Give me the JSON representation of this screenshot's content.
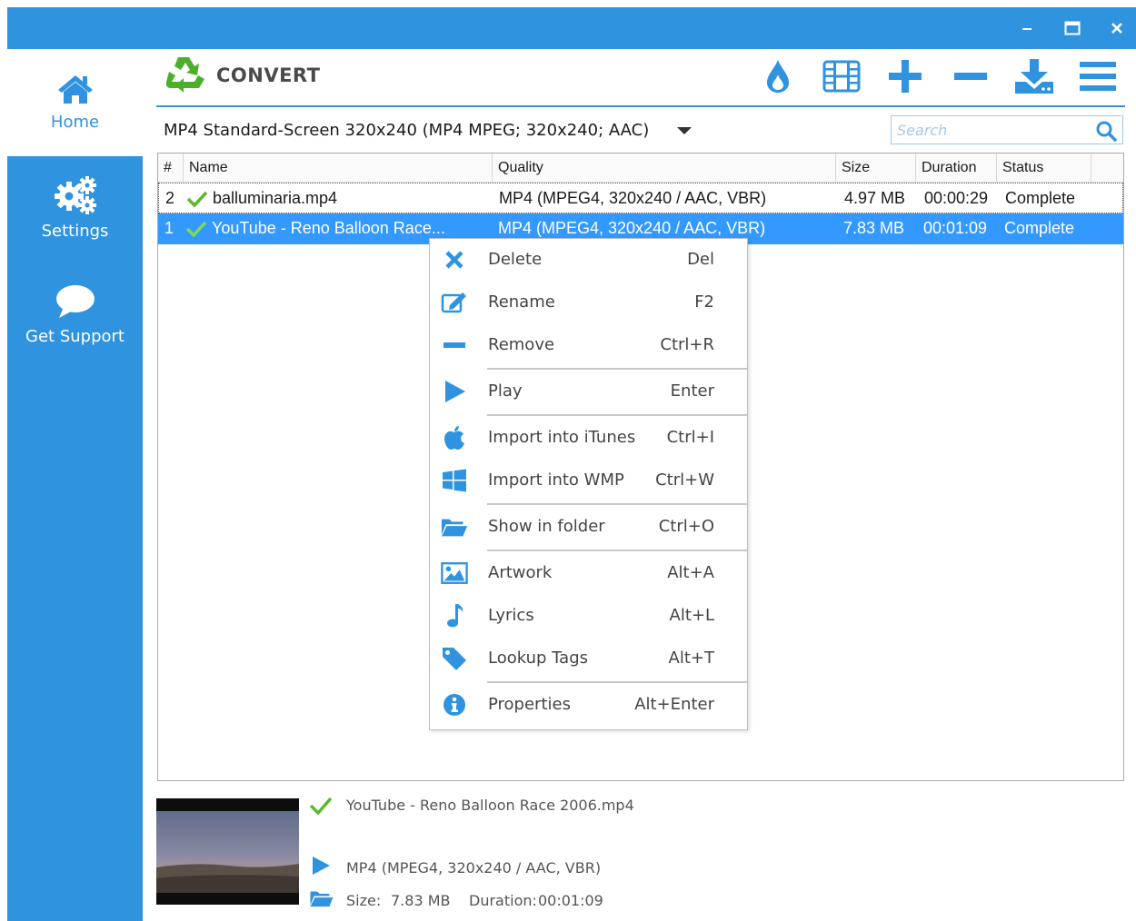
{
  "window": {
    "controls": {
      "minimize_icon": "minimize-icon",
      "maximize_icon": "maximize-icon",
      "close_icon": "close-icon"
    }
  },
  "sidebar": {
    "items": [
      {
        "label": "Home",
        "icon": "home-icon"
      },
      {
        "label": "Settings",
        "icon": "gears-icon"
      },
      {
        "label": "Get Support",
        "icon": "chat-bubble-icon"
      }
    ]
  },
  "toolbar": {
    "title": "CONVERT",
    "logo_icon": "recycle-icon",
    "buttons": [
      "burn-icon",
      "film-icon",
      "add-icon",
      "remove-icon",
      "download-icon",
      "menu-icon"
    ]
  },
  "preset": {
    "selected": "MP4 Standard-Screen 320x240 (MP4 MPEG; 320x240; AAC)"
  },
  "search": {
    "placeholder": "Search"
  },
  "table": {
    "columns": [
      "#",
      "Name",
      "Quality",
      "Size",
      "Duration",
      "Status"
    ],
    "rows": [
      {
        "num": "2",
        "name": "balluminaria.mp4",
        "quality": "MP4  (MPEG4, 320x240 / AAC, VBR)",
        "size": "4.97 MB",
        "duration": "00:00:29",
        "status": "Complete"
      },
      {
        "num": "1",
        "name": "YouTube  -  Reno  Balloon  Race...",
        "quality": "MP4  (MPEG4, 320x240 / AAC, VBR)",
        "size": "7.83 MB",
        "duration": "00:01:09",
        "status": "Complete"
      }
    ]
  },
  "context_menu": {
    "items": [
      {
        "label": "Delete",
        "shortcut": "Del",
        "icon": "delete-x-icon"
      },
      {
        "label": "Rename",
        "shortcut": "F2",
        "icon": "rename-icon"
      },
      {
        "label": "Remove",
        "shortcut": "Ctrl+R",
        "icon": "remove-icon"
      },
      {
        "label": "Play",
        "shortcut": "Enter",
        "icon": "play-icon"
      },
      {
        "label": "Import into iTunes",
        "shortcut": "Ctrl+I",
        "icon": "apple-icon"
      },
      {
        "label": "Import into WMP",
        "shortcut": "Ctrl+W",
        "icon": "windows-icon"
      },
      {
        "label": "Show in folder",
        "shortcut": "Ctrl+O",
        "icon": "folder-icon"
      },
      {
        "label": "Artwork",
        "shortcut": "Alt+A",
        "icon": "image-icon"
      },
      {
        "label": "Lyrics",
        "shortcut": "Alt+L",
        "icon": "music-note-icon"
      },
      {
        "label": "Lookup Tags",
        "shortcut": "Alt+T",
        "icon": "tag-icon"
      },
      {
        "label": "Properties",
        "shortcut": "Alt+Enter",
        "icon": "info-icon"
      }
    ]
  },
  "details": {
    "filename": "YouTube - Reno Balloon Race 2006.mp4",
    "quality": "MP4  (MPEG4, 320x240 / AAC, VBR)",
    "size_label": "Size:",
    "size_value": "7.83 MB",
    "duration_label": "Duration:",
    "duration_value": "00:01:09"
  },
  "colors": {
    "accent": "#2f93df",
    "selection": "#3399ff",
    "success": "#5cb82e",
    "delete_icon": "#2f93df"
  }
}
